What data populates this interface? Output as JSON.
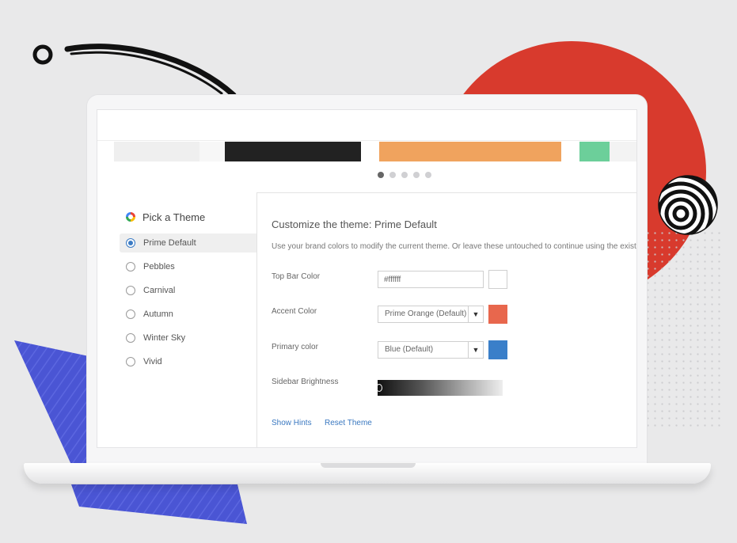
{
  "colors": {
    "accent_red": "#d83a2d",
    "deco_blue": "#4a55d4",
    "link_blue": "#3a78c0"
  },
  "carousel": {
    "swatches": [
      "#efefef",
      "#f7f7f7",
      "#222222",
      "#ffffff",
      "#f0a35e",
      "#ffffff",
      "#6ccf9a",
      "#f3f3f3"
    ],
    "page_count": 5,
    "active_page": 1
  },
  "theme_list": {
    "heading": "Pick a Theme",
    "icon": "color-wheel-icon",
    "items": [
      {
        "label": "Prime Default",
        "selected": true
      },
      {
        "label": "Pebbles",
        "selected": false
      },
      {
        "label": "Carnival",
        "selected": false
      },
      {
        "label": "Autumn",
        "selected": false
      },
      {
        "label": "Winter Sky",
        "selected": false
      },
      {
        "label": "Vivid",
        "selected": false
      }
    ]
  },
  "customize": {
    "title": "Customize the theme: Prime Default",
    "description": "Use your brand colors to modify the current theme. Or leave these untouched to continue using the exist",
    "top_bar": {
      "label": "Top Bar Color",
      "value": "#ffffff",
      "swatch": "#ffffff"
    },
    "accent": {
      "label": "Accent Color",
      "value": "Prime Orange (Default)",
      "swatch": "#e8674d"
    },
    "primary": {
      "label": "Primary color",
      "value": "Blue (Default)",
      "swatch": "#3a7fc9"
    },
    "sidebar_brightness": {
      "label": "Sidebar Brightness",
      "value": 0
    },
    "show_hints": "Show Hints",
    "reset_theme": "Reset Theme"
  }
}
